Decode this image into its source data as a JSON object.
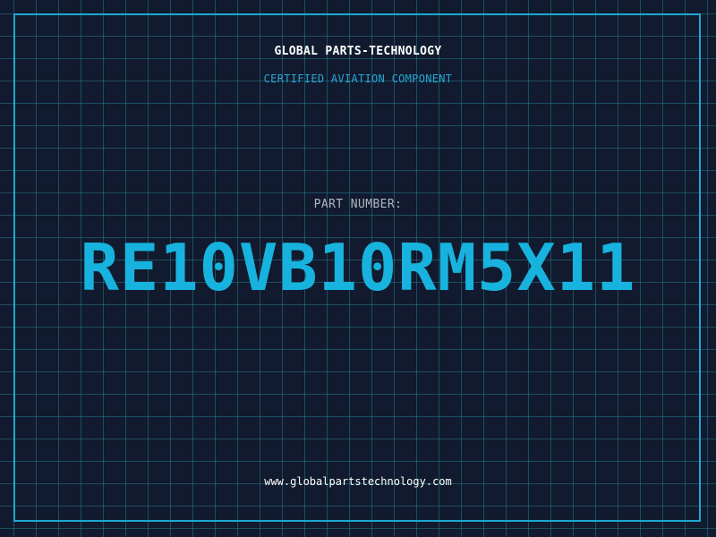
{
  "header": {
    "company": "GLOBAL PARTS-TECHNOLOGY",
    "subtitle": "CERTIFIED AVIATION COMPONENT"
  },
  "part": {
    "label": "PART NUMBER:",
    "number": "RE10VB10RM5X11"
  },
  "footer": {
    "website": "www.globalpartstechnology.com"
  },
  "colors": {
    "background": "#111a2e",
    "grid": "#26768a",
    "accent": "#1ea7cf",
    "part_number": "#17b3de",
    "label": "#aeb6c4"
  }
}
